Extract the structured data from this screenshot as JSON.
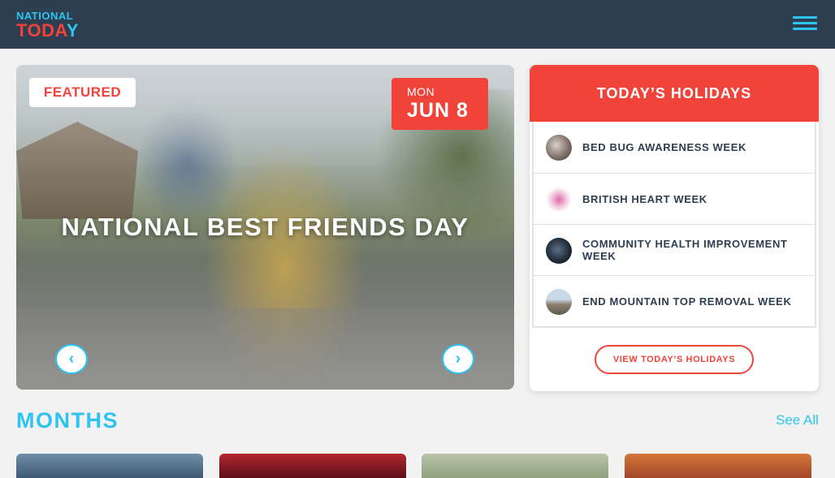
{
  "header": {
    "logo_line1": "NATIONAL",
    "logo_line2_a": "TODA",
    "logo_line2_b": "Y"
  },
  "featured": {
    "badge": "FEATURED",
    "day_of_week": "MON",
    "date": "JUN 8",
    "title": "NATIONAL BEST FRIENDS DAY",
    "prev_icon": "‹",
    "next_icon": "›"
  },
  "todays_holidays": {
    "heading": "TODAY’S HOLIDAYS",
    "items": [
      {
        "label": "BED BUG AWARENESS WEEK",
        "thumb_color": "#7a6a63"
      },
      {
        "label": "BRITISH HEART WEEK",
        "thumb_color": "#e0a7c4"
      },
      {
        "label": "COMMUNITY HEALTH IMPROVEMENT WEEK",
        "thumb_color": "#1f2a36"
      },
      {
        "label": "END MOUNTAIN TOP REMOVAL WEEK",
        "thumb_color": "#8c8f8a"
      }
    ],
    "view_button": "VIEW TODAY’S HOLIDAYS"
  },
  "months": {
    "heading": "MONTHS",
    "see_all": "See All"
  },
  "colors": {
    "accent_red": "#f0443a",
    "accent_blue": "#2ec4f2",
    "header_bg": "#2d3e50"
  }
}
